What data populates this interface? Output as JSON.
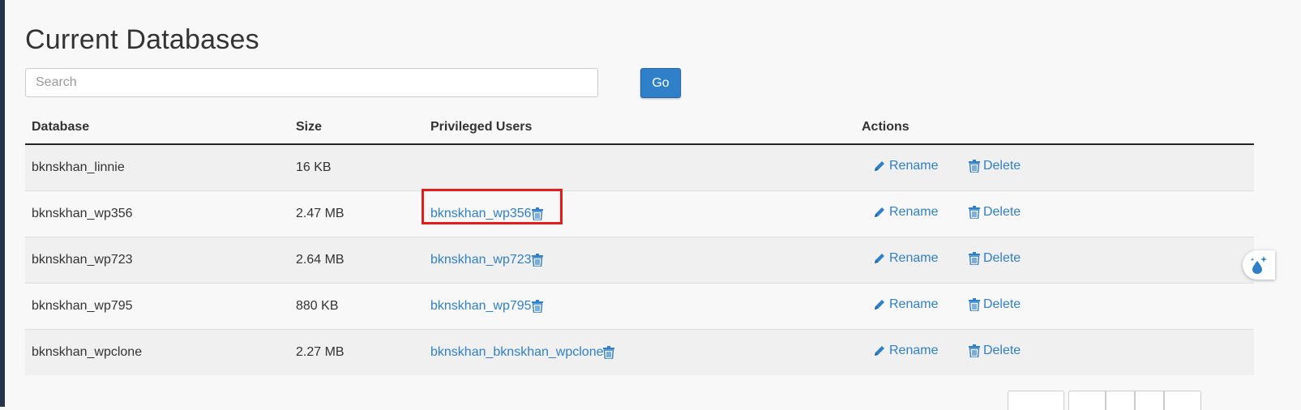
{
  "page": {
    "title": "Current Databases"
  },
  "search": {
    "placeholder": "Search",
    "value": "",
    "go_label": "Go"
  },
  "table": {
    "headers": {
      "database": "Database",
      "size": "Size",
      "users": "Privileged Users",
      "actions": "Actions"
    },
    "action_labels": {
      "rename": "Rename",
      "delete": "Delete"
    },
    "rows": [
      {
        "database": "bknskhan_linnie",
        "size": "16 KB",
        "user": ""
      },
      {
        "database": "bknskhan_wp356",
        "size": "2.47 MB",
        "user": "bknskhan_wp356"
      },
      {
        "database": "bknskhan_wp723",
        "size": "2.64 MB",
        "user": "bknskhan_wp723"
      },
      {
        "database": "bknskhan_wp795",
        "size": "880 KB",
        "user": "bknskhan_wp795"
      },
      {
        "database": "bknskhan_wpclone",
        "size": "2.27 MB",
        "user": "bknskhan_bknskhan_wpclone"
      }
    ]
  },
  "colors": {
    "link": "#2f7fc9",
    "button": "#2f7fc9",
    "highlight": "#e31c1c"
  },
  "icons": {
    "rename": "pencil-icon",
    "delete": "trash-icon",
    "widget": "droplet-sparkle-icon"
  }
}
